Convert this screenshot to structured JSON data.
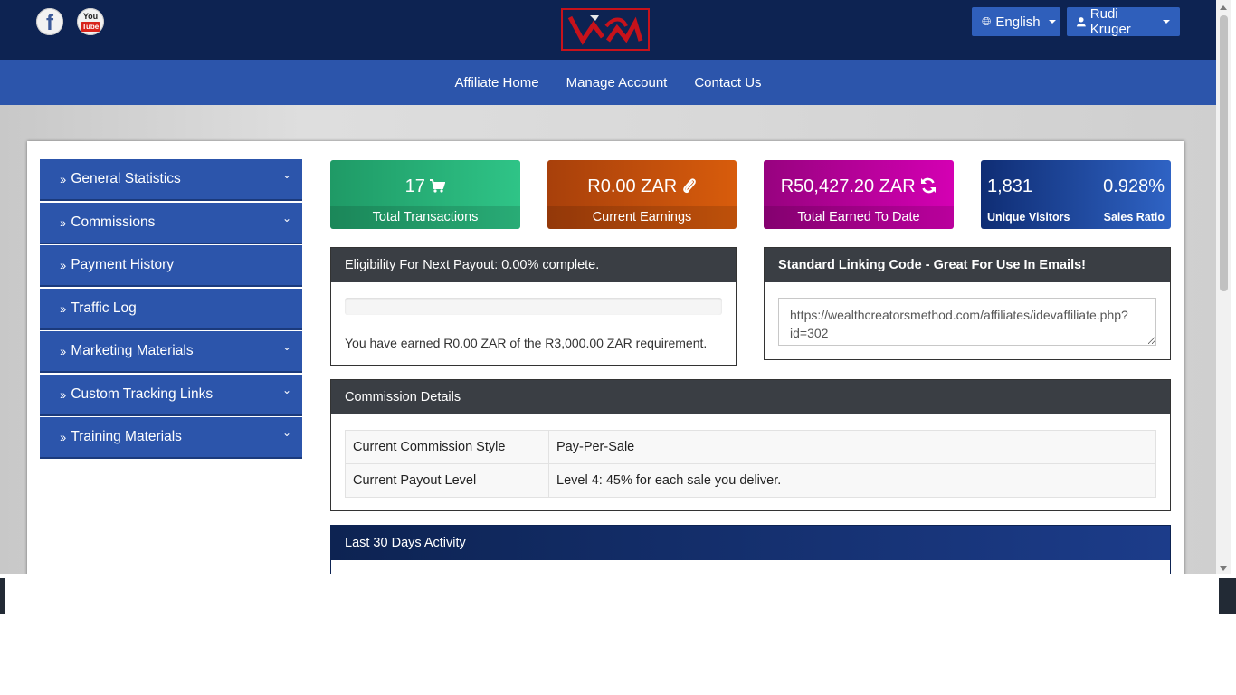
{
  "header": {
    "social": [
      {
        "name": "facebook",
        "glyph": "f"
      },
      {
        "name": "youtube",
        "line1": "You",
        "line2": "Tube"
      }
    ],
    "logo_text": "WCM",
    "language_label": "English",
    "user_label": "Rudi Kruger"
  },
  "nav": {
    "items": [
      "Affiliate Home",
      "Manage Account",
      "Contact Us"
    ]
  },
  "sidebar": {
    "items": [
      {
        "label": "General Statistics",
        "expandable": true
      },
      {
        "label": "Commissions",
        "expandable": true
      },
      {
        "label": "Payment History",
        "expandable": false
      },
      {
        "label": "Traffic Log",
        "expandable": false
      },
      {
        "label": "Marketing Materials",
        "expandable": true
      },
      {
        "label": "Custom Tracking Links",
        "expandable": true
      },
      {
        "label": "Training Materials",
        "expandable": true
      }
    ]
  },
  "stats": {
    "transactions": {
      "value": "17",
      "label": "Total Transactions",
      "icon": "cart-icon"
    },
    "current_earnings": {
      "value": "R0.00 ZAR",
      "label": "Current Earnings",
      "icon": "paperclip-icon"
    },
    "total_earned": {
      "value": "R50,427.20 ZAR",
      "label": "Total Earned To Date",
      "icon": "refresh-icon"
    },
    "visitors": {
      "value": "1,831",
      "label": "Unique Visitors",
      "ratio_value": "0.928%",
      "ratio_label": "Sales Ratio"
    }
  },
  "payout": {
    "title": "Eligibility For Next Payout: 0.00% complete.",
    "progress": 0.0,
    "text": "You have earned R0.00 ZAR of the R3,000.00 ZAR requirement."
  },
  "linking": {
    "title": "Standard Linking Code - Great For Use In Emails!",
    "code": "https://wealthcreatorsmethod.com/affiliates/idevaffiliate.php?id=302"
  },
  "commission": {
    "title": "Commission Details",
    "rows": [
      {
        "key": "Current Commission Style",
        "value": "Pay-Per-Sale"
      },
      {
        "key": "Current Payout Level",
        "value": "Level 4: 45% for each sale you deliver."
      }
    ]
  },
  "activity": {
    "title": "Last 30 Days Activity"
  },
  "colors": {
    "header_bg": "#0d2352",
    "nav_bg": "#2c55ab",
    "green": "#2fc487",
    "orange": "#d85c0c",
    "magenta": "#d400b3",
    "blue": "#2f63c4"
  }
}
